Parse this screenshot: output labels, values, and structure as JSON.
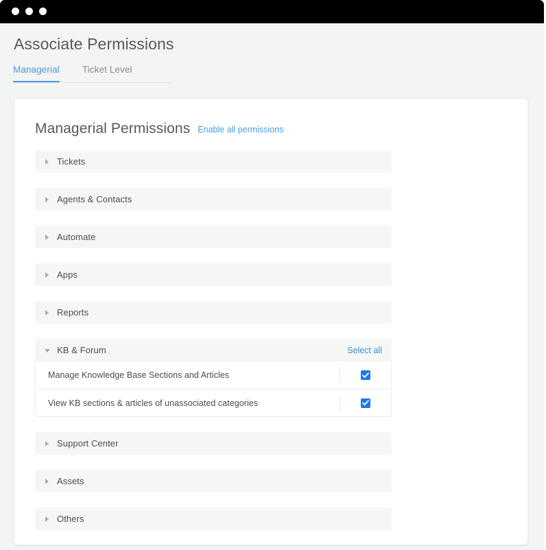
{
  "window": {
    "titlebar_dots": [
      "dot-1",
      "dot-2",
      "dot-3"
    ]
  },
  "header": {
    "page_title": "Associate Permissions"
  },
  "tabs": [
    {
      "label": "Managerial",
      "active": true
    },
    {
      "label": "Ticket Level",
      "active": false
    }
  ],
  "card": {
    "title": "Managerial Permissions",
    "enable_all_label": "Enable all permissions",
    "select_all_label": "Select all"
  },
  "colors": {
    "accent_blue": "#4a9ae0",
    "link_blue": "#3b8fd8",
    "checkbox_blue": "#1a7aef",
    "section_bg": "#f5f6f6",
    "page_bg": "#f3f4f4",
    "text_dark": "#4a4b4d",
    "title_gray": "#58595b"
  },
  "sections": [
    {
      "label": "Tickets",
      "expanded": false,
      "caret_icon": "caret-right-icon"
    },
    {
      "label": "Agents & Contacts",
      "expanded": false,
      "caret_icon": "caret-right-icon"
    },
    {
      "label": "Automate",
      "expanded": false,
      "caret_icon": "caret-right-icon"
    },
    {
      "label": "Apps",
      "expanded": false,
      "caret_icon": "caret-right-icon"
    },
    {
      "label": "Reports",
      "expanded": false,
      "caret_icon": "caret-right-icon"
    },
    {
      "label": "KB & Forum",
      "expanded": true,
      "caret_icon": "caret-down-icon",
      "select_all_label": "Select all",
      "permissions": [
        {
          "label": "Manage Knowledge Base Sections and Articles",
          "checked": true
        },
        {
          "label": "View KB sections & articles of unassociated categories",
          "checked": true
        }
      ]
    },
    {
      "label": "Support Center",
      "expanded": false,
      "caret_icon": "caret-right-icon"
    },
    {
      "label": "Assets",
      "expanded": false,
      "caret_icon": "caret-right-icon"
    },
    {
      "label": "Others",
      "expanded": false,
      "caret_icon": "caret-right-icon"
    }
  ]
}
